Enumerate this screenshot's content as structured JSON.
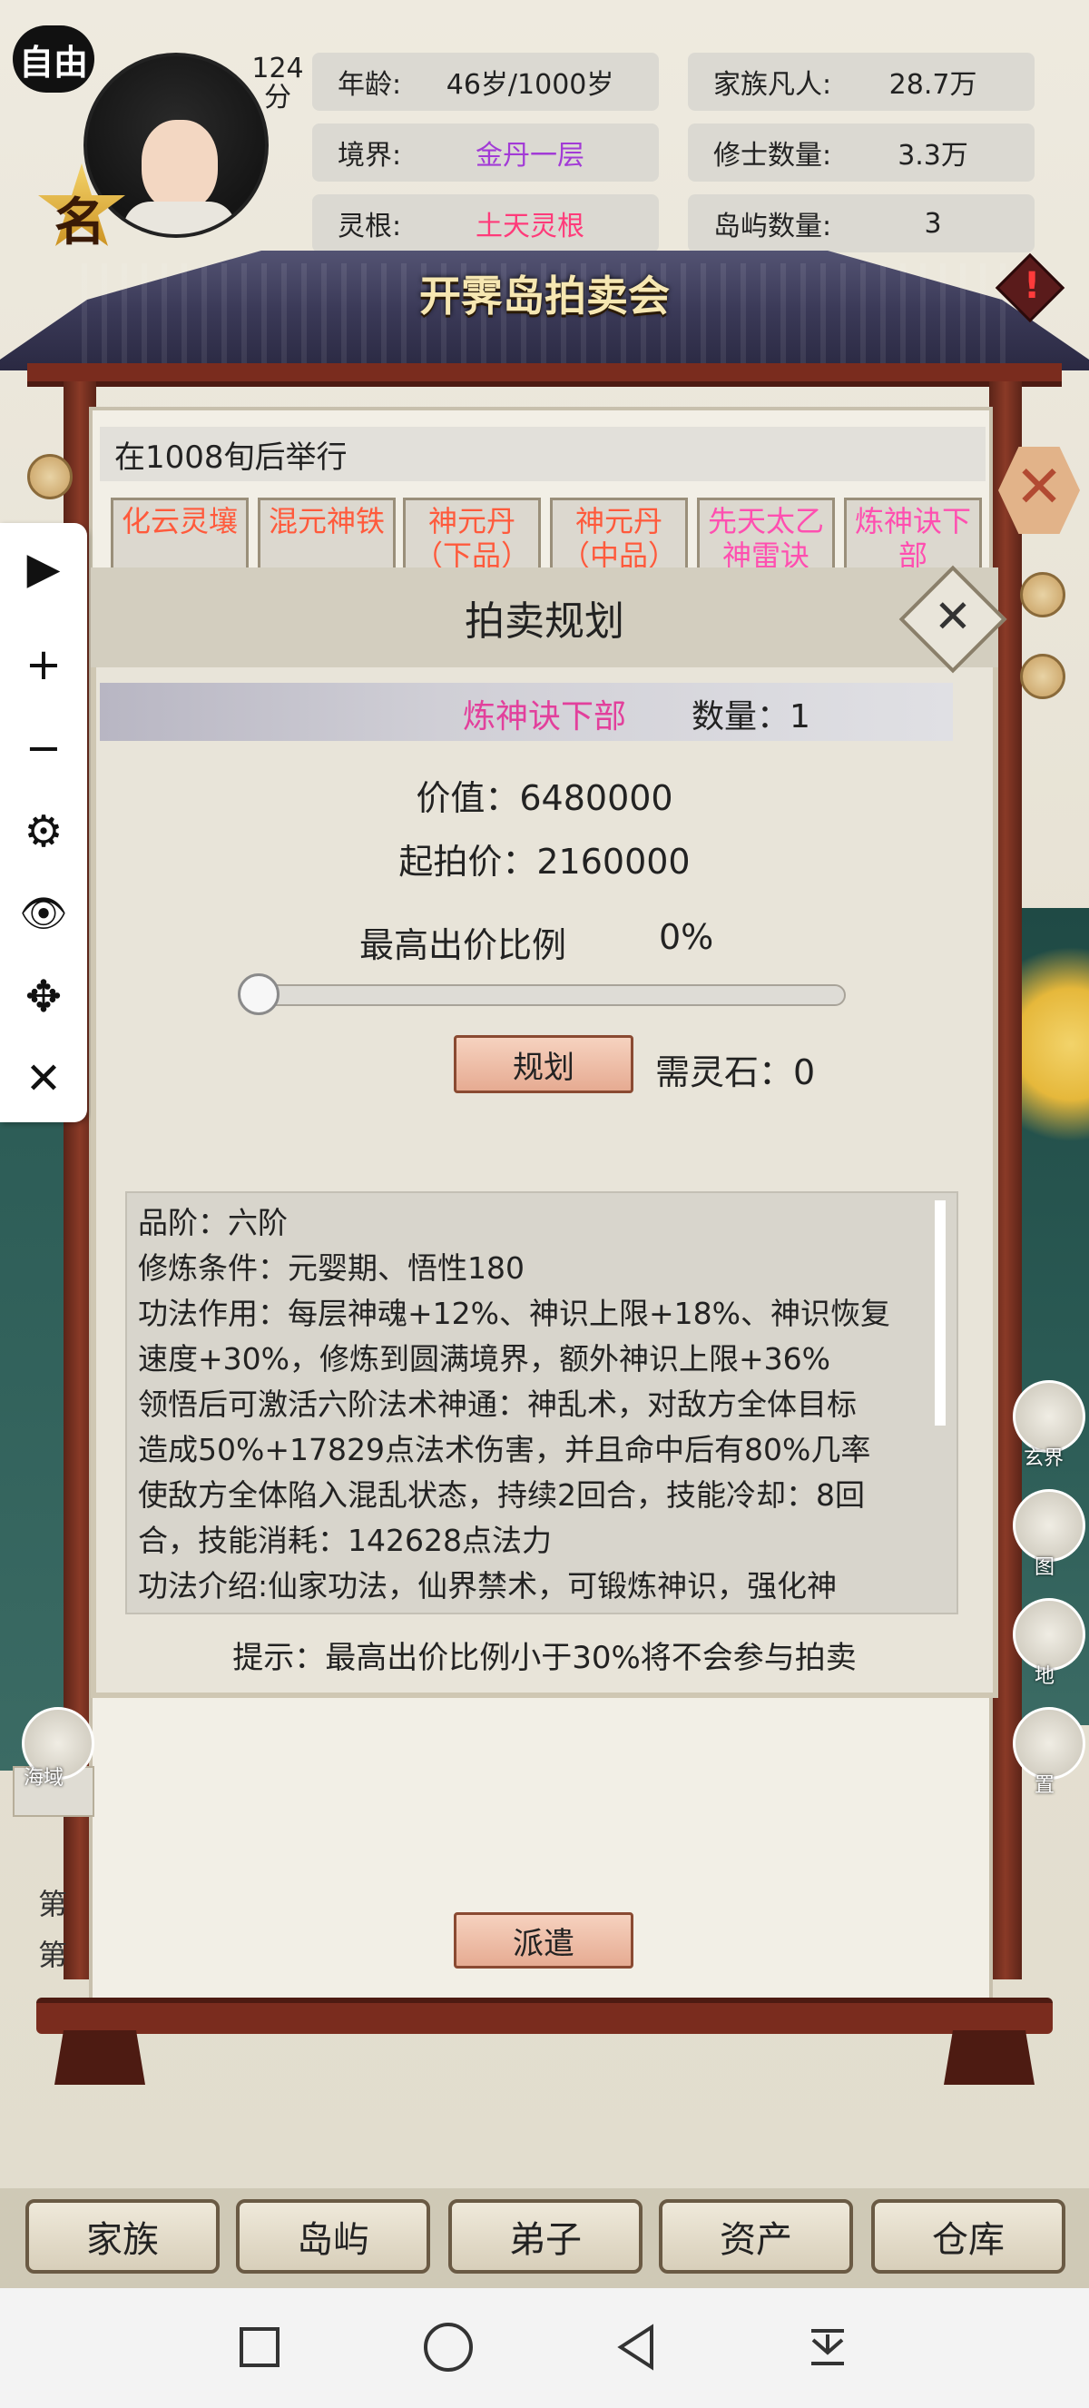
{
  "status": {
    "free_label": "自由",
    "score_value": "124",
    "score_unit": "分",
    "name_char": "名",
    "age_label": "年龄:",
    "age_value": "46岁/1000岁",
    "realm_label": "境界:",
    "realm_value": "金丹一层",
    "root_label": "灵根:",
    "root_value": "土天灵根",
    "family_label": "家族凡人:",
    "family_value": "28.7万",
    "cultivators_label": "修士数量:",
    "cultivators_value": "3.3万",
    "islands_label": "岛屿数量:",
    "islands_value": "3",
    "realm_color": "#a23bd6",
    "root_color": "#ff3b7a"
  },
  "auction": {
    "title": "开霁岛拍卖会",
    "when": "在1008旬后举行",
    "items": [
      {
        "label": "化云灵壤",
        "color": "#ff5a3c"
      },
      {
        "label": "混元神铁",
        "color": "#ff5a3c"
      },
      {
        "label": "神元丹（下品）",
        "color": "#ff5a3c"
      },
      {
        "label": "神元丹（中品）",
        "color": "#ff5a3c"
      },
      {
        "label": "先天太乙神雷诀",
        "color": "#ff4fb0"
      },
      {
        "label": "炼神诀下部",
        "color": "#ff4fb0"
      }
    ],
    "dispatch_label": "派遣",
    "side_line_1": "第",
    "side_line_2": "第",
    "close_icon": "close-hex-icon",
    "alert_mark": "!"
  },
  "modal": {
    "title": "拍卖规划",
    "close_glyph": "✕",
    "item_name": "炼神诀下部",
    "quantity": "数量：1",
    "value": "价值：6480000",
    "start_price": "起拍价：2160000",
    "ratio_label": "最高出价比例",
    "ratio_value": "0%",
    "ratio_fraction": 0,
    "plan_label": "规划",
    "need_stone": "需灵石：0",
    "description": [
      "品阶：六阶",
      "修炼条件：元婴期、悟性180",
      "功法作用：每层神魂+12%、神识上限+18%、神识恢复",
      "速度+30%，修炼到圆满境界，额外神识上限+36%",
      "领悟后可激活六阶法术神通：神乱术，对敌方全体目标",
      "造成50%+17829点法术伤害，并且命中后有80%几率",
      "使敌方全体陷入混乱状态，持续2回合，技能冷却：8回",
      "合，技能消耗：142628点法力",
      "功法介绍:仙家功法，仙界禁术，可锻炼神识，强化神"
    ],
    "hint": "提示：最高出价比例小于30%将不会参与拍卖"
  },
  "toolbar": {
    "play": "▶",
    "plus": "+",
    "minus": "−",
    "gear": "⚙",
    "eye": "👁",
    "move": "✥",
    "close": "✕"
  },
  "map_labels": {
    "right_1": "玄界",
    "right_2": "图",
    "right_3": "地",
    "right_4": "置",
    "left_1": "海域"
  },
  "bottom_nav": [
    "家族",
    "岛屿",
    "弟子",
    "资产",
    "仓库"
  ],
  "android_nav": [
    "square",
    "circle",
    "back",
    "down"
  ]
}
